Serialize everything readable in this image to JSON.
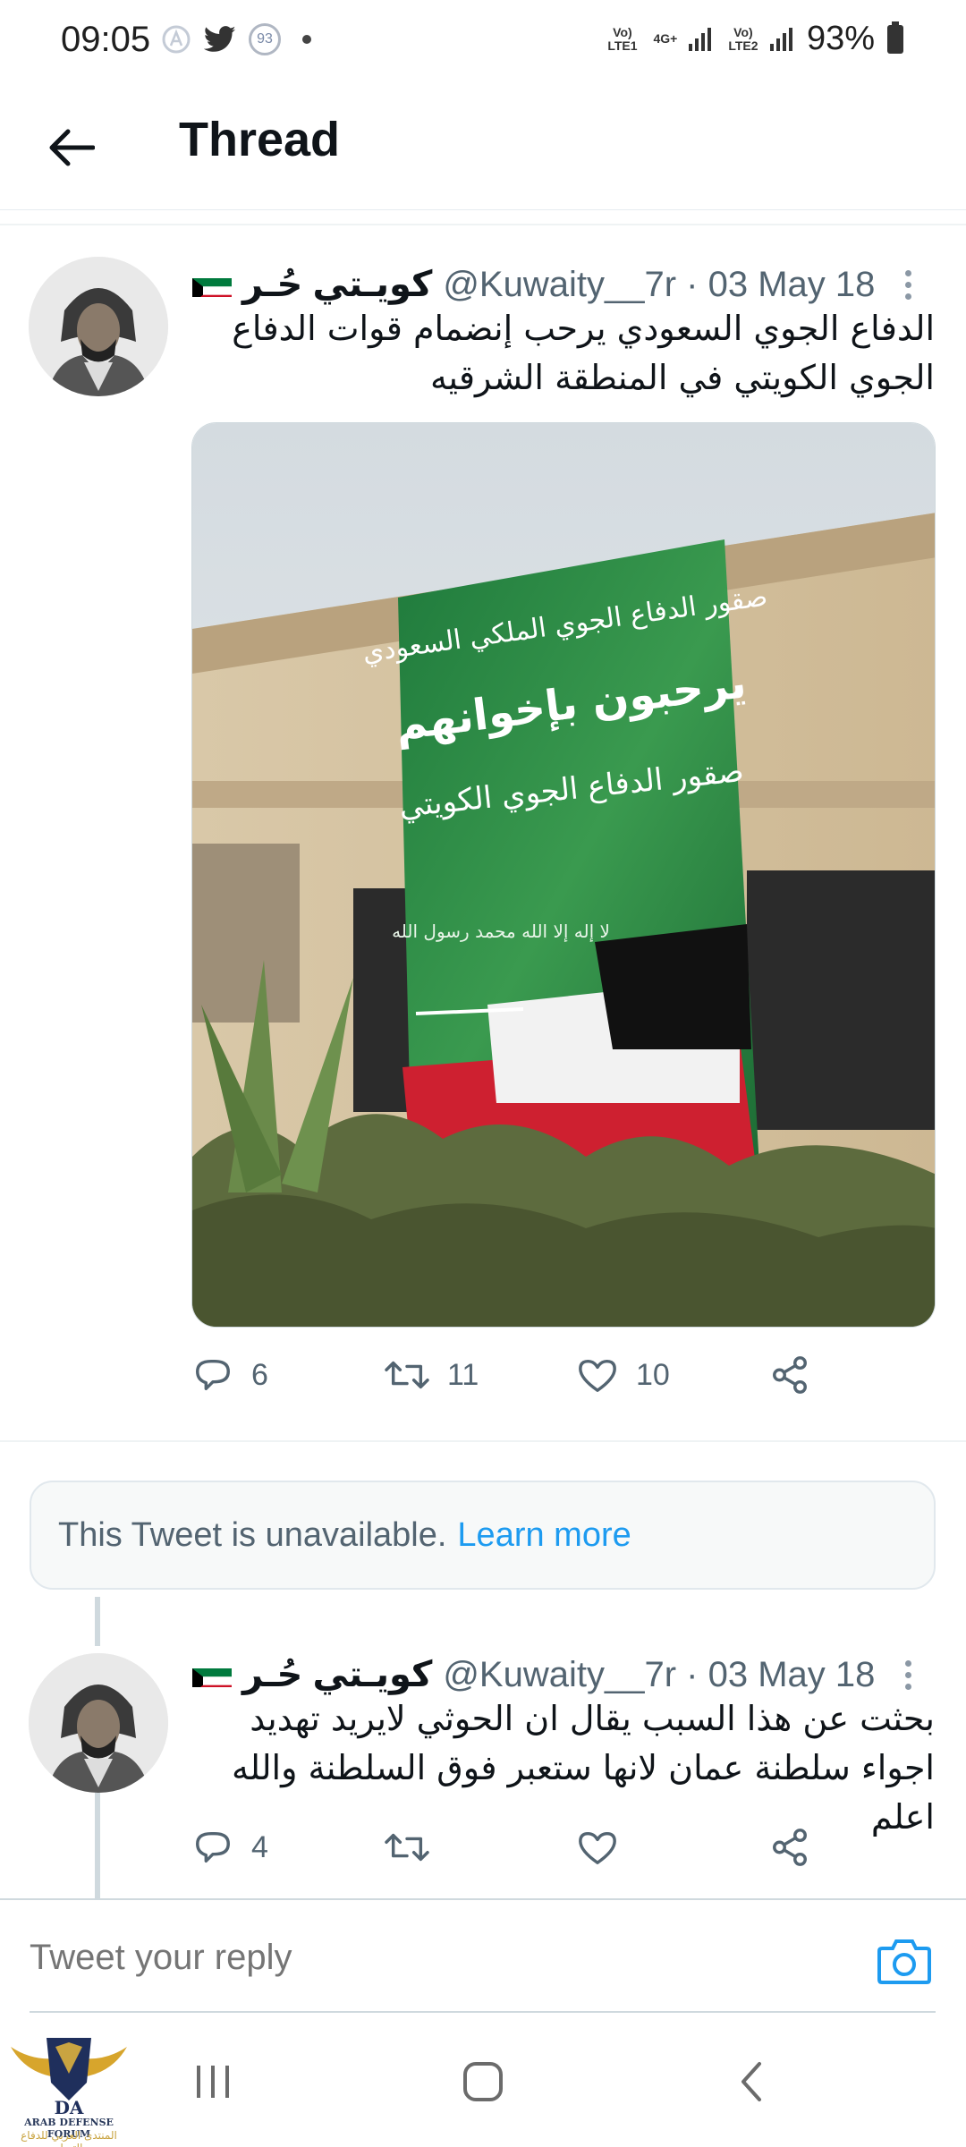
{
  "status_bar": {
    "time": "09:05",
    "notification_badge": "93",
    "network_1": "Vo) LTE1",
    "network_2": "4G+",
    "network_3": "Vo) LTE2",
    "battery": "93%"
  },
  "header": {
    "title": "Thread"
  },
  "tweets": [
    {
      "author_name": "كويـتي حُـر",
      "handle_date": "@Kuwaity__7r · 03 May 18",
      "text": "الدفاع الجوي السعودي يرحب إنضمام قوات الدفاع الجوي الكويتي في المنطقة الشرقيه",
      "media": {
        "banner_line1": "صقور الدفاع الجوي الملكي السعودي",
        "banner_line2": "يرحبون بإخوانهم",
        "banner_line3": "صقور الدفاع الجوي الكويتي",
        "banner_seal": "لا إله إلا الله محمد رسول الله"
      },
      "replies": "6",
      "retweets": "11",
      "likes": "10"
    },
    {
      "author_name": "كويـتي حُـر",
      "handle_date": "@Kuwaity__7r · 03 May 18",
      "text": "بحثت عن هذا السبب يقال ان الحوثي لايريد تهديد اجواء سلطنة عمان لانها ستعبر فوق السلطنة والله اعلم",
      "replies": "4",
      "retweets": "",
      "likes": ""
    }
  ],
  "unavailable": {
    "message": "This Tweet is unavailable.",
    "link": "Learn more"
  },
  "reply": {
    "placeholder": "Tweet your reply"
  },
  "watermark": {
    "logo_letters": "DA",
    "name_en": "ARAB DEFENSE FORUM",
    "name_ar": "المنتدى العربي للدفاع والتسليح"
  },
  "colors": {
    "accent": "#1d9bf0",
    "secondary_text": "#536471",
    "divider": "#cfd9de"
  },
  "icons": [
    "back-arrow-icon",
    "more-vertical-icon",
    "reply-icon",
    "retweet-icon",
    "like-icon",
    "share-icon",
    "camera-icon",
    "recents-icon",
    "home-icon",
    "back-icon"
  ]
}
